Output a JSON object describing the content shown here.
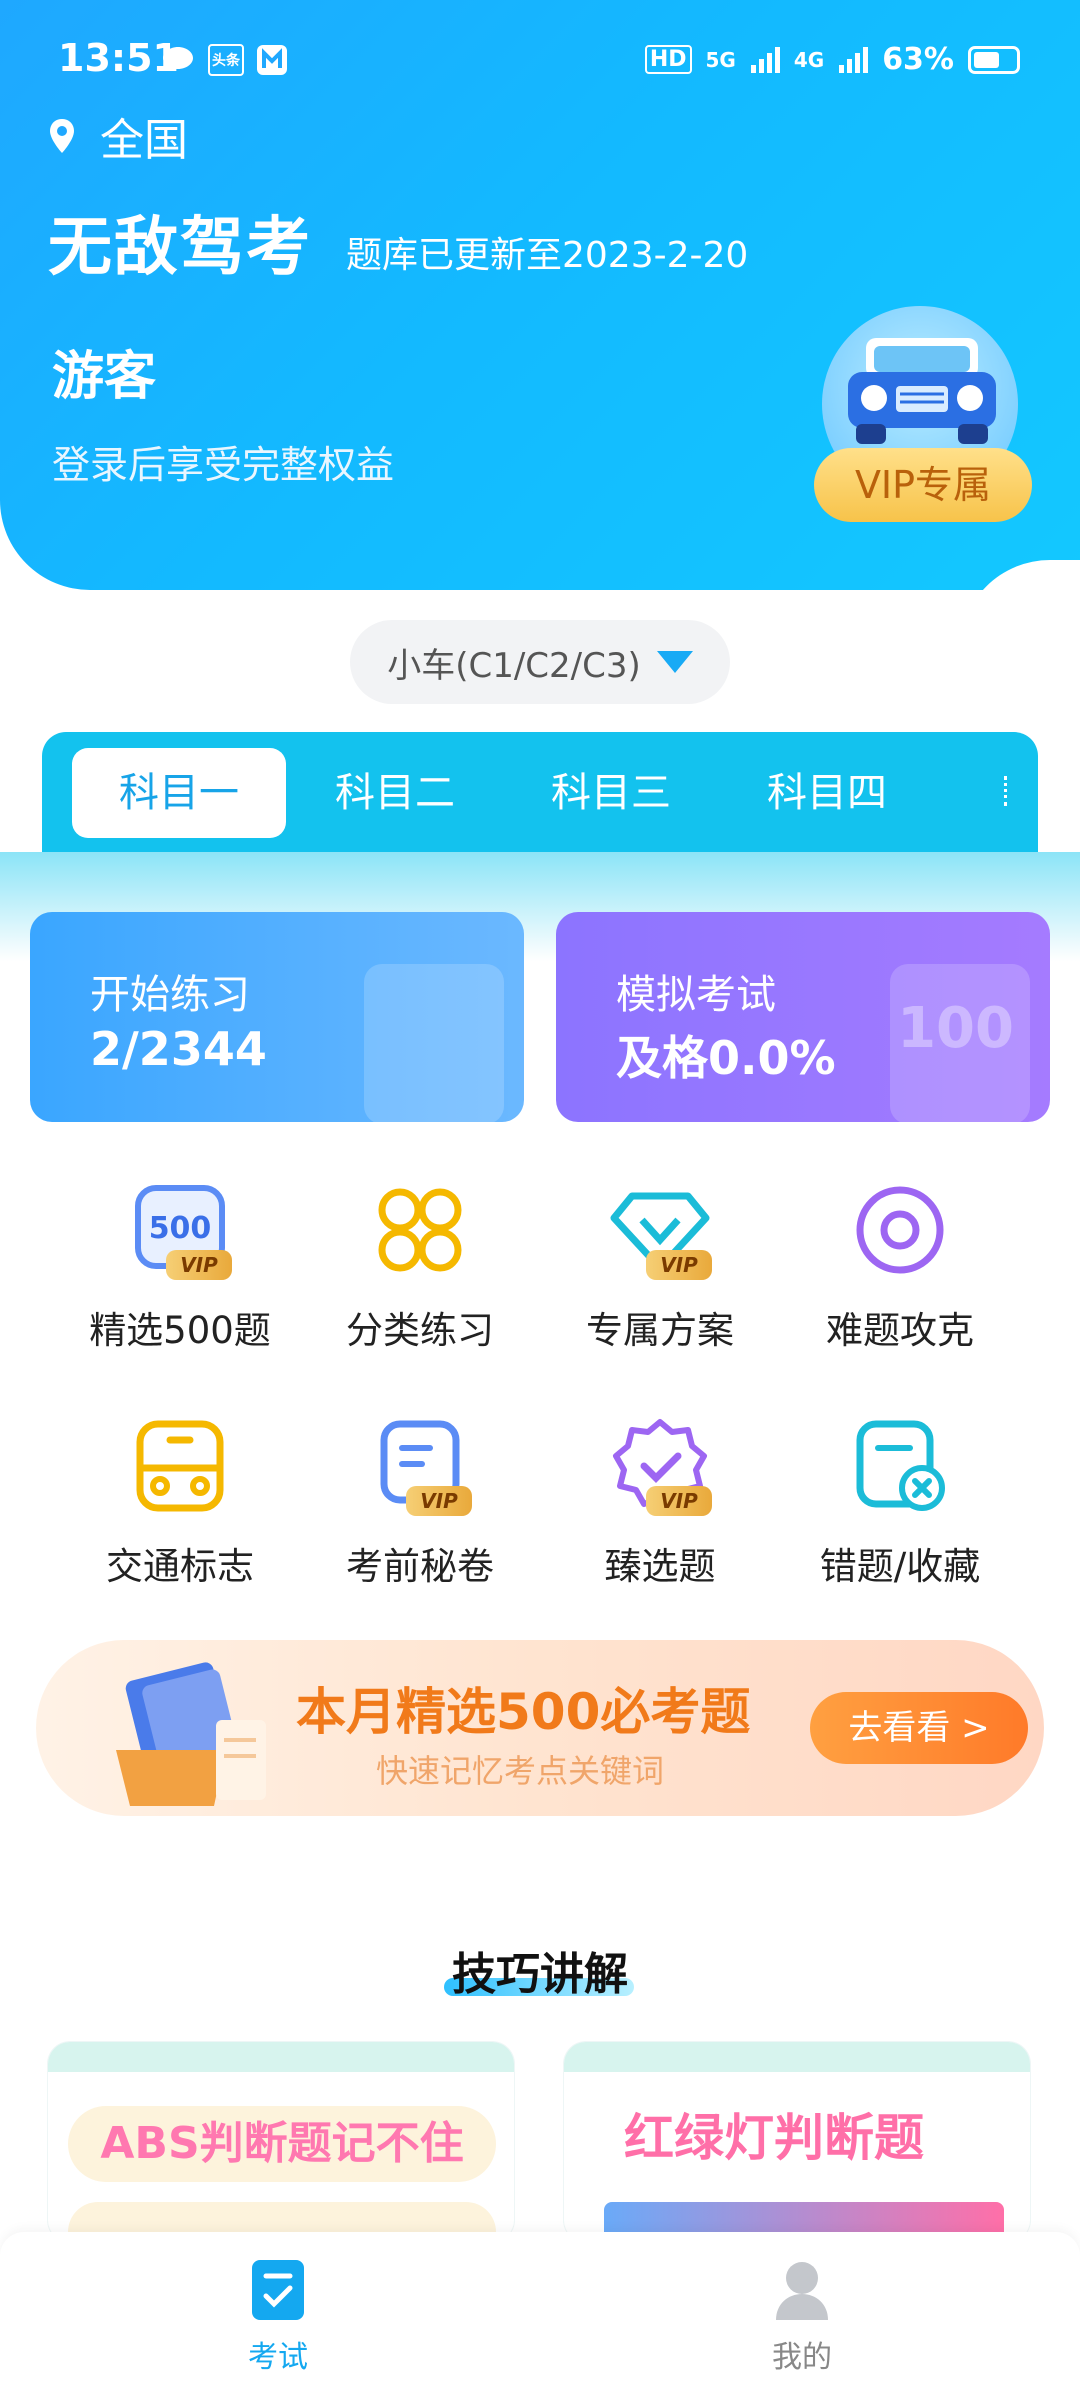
{
  "status_bar": {
    "time": "13:51",
    "icons": [
      "chat-icon",
      "toutiao-icon",
      "app-icon"
    ],
    "hd": "HD",
    "net1": "5G",
    "net2": "4G",
    "battery": "63%",
    "battery_level": 0.63
  },
  "header": {
    "location": "全国",
    "app_title": "无敌驾考",
    "update_text": "题库已更新至2023-2-20",
    "user_name": "游客",
    "login_hint": "登录后享受完整权益",
    "vip_label": "VIP专属"
  },
  "car_select": {
    "label": "小车(C1/C2/C3)"
  },
  "subject_tabs": [
    {
      "label": "科目一",
      "active": true
    },
    {
      "label": "科目二",
      "active": false
    },
    {
      "label": "科目三",
      "active": false
    },
    {
      "label": "科目四",
      "active": false
    }
  ],
  "cards": {
    "practice": {
      "title": "开始练习",
      "value": "2/2344"
    },
    "exam": {
      "title": "模拟考试",
      "value": "及格0.0%",
      "deco": "100"
    }
  },
  "grid": [
    {
      "label": "精选500题",
      "icon": "500-icon",
      "vip": true
    },
    {
      "label": "分类练习",
      "icon": "category-icon",
      "vip": false
    },
    {
      "label": "专属方案",
      "icon": "diamond-icon",
      "vip": true
    },
    {
      "label": "难题攻克",
      "icon": "target-icon",
      "vip": false
    },
    {
      "label": "交通标志",
      "icon": "bus-icon",
      "vip": false
    },
    {
      "label": "考前秘卷",
      "icon": "scroll-icon",
      "vip": true
    },
    {
      "label": "臻选题",
      "icon": "badge-check-icon",
      "vip": true
    },
    {
      "label": "错题/收藏",
      "icon": "error-doc-icon",
      "vip": false
    }
  ],
  "vip_tag": "VIP",
  "banner": {
    "title": "本月精选500必考题",
    "subtitle": "快速记忆考点关键词",
    "button": "去看看 >"
  },
  "tips": {
    "title": "技巧讲解",
    "card1": "ABS判断题记不住",
    "card2": "红绿灯判断题"
  },
  "bottom_nav": [
    {
      "label": "考试",
      "active": true
    },
    {
      "label": "我的",
      "active": false
    }
  ],
  "colors": {
    "header_blue": "#13b9ff",
    "accent_blue": "#17a4e8",
    "vip_gold": "#f7c34a",
    "banner_orange": "#ff7a29"
  }
}
